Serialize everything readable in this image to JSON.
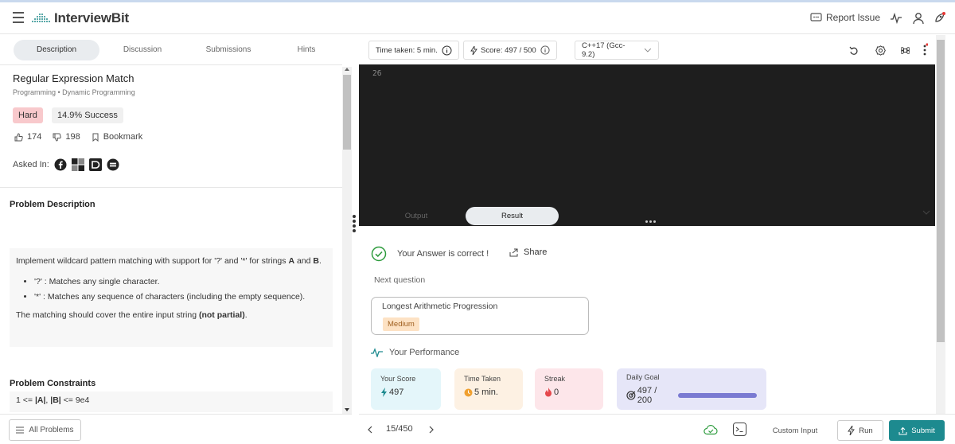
{
  "header": {
    "brand": "InterviewBit",
    "report_label": "Report Issue"
  },
  "left_tabs": [
    {
      "label": "Description",
      "active": true
    },
    {
      "label": "Discussion"
    },
    {
      "label": "Submissions"
    },
    {
      "label": "Hints"
    }
  ],
  "problem": {
    "title": "Regular Expression Match",
    "tags": "Programming • Dynamic Programming",
    "difficulty": "Hard",
    "success": "14.9% Success",
    "likes": "174",
    "dislikes": "198",
    "bookmark_label": "Bookmark",
    "asked_in_label": "Asked In:",
    "companies": [
      "facebook-icon",
      "microsoft-icon",
      "directi-icon",
      "company-icon"
    ]
  },
  "description": {
    "heading": "Problem Description",
    "intro_pre": "Implement wildcard pattern matching with support for '?' and '*' for strings ",
    "intro_a": "A",
    "intro_and": " and ",
    "intro_b": "B",
    "intro_end": ".",
    "bullet1": "'?' : Matches any single character.",
    "bullet2": "'*' : Matches any sequence of characters (including the empty sequence).",
    "match_pre": "The matching should cover the entire input string ",
    "match_bold": "(not partial)",
    "match_end": "."
  },
  "constraints": {
    "heading": "Problem Constraints",
    "pre": "1 <= ",
    "a": "|A|",
    "mid": ", ",
    "b": "|B|",
    "post": " <= 9e4"
  },
  "bottom_left": {
    "all_problems": "All Problems"
  },
  "toolbar": {
    "time_taken": "Time taken: 5 min.",
    "score": "Score: 497 / 500",
    "language": "C++17 (Gcc-9.2)"
  },
  "editor": {
    "line_number": "26"
  },
  "result_tabs": [
    {
      "label": "Output"
    },
    {
      "label": "Result",
      "active": true
    }
  ],
  "result": {
    "message": "Your Answer is correct !",
    "share": "Share",
    "next_label": "Next question",
    "next_title": "Longest Arithmetic Progression",
    "next_difficulty": "Medium",
    "performance_label": "Your Performance"
  },
  "performance": {
    "score_label": "Your Score",
    "score_value": "497",
    "time_label": "Time Taken",
    "time_value": "5 min.",
    "streak_label": "Streak",
    "streak_value": "0",
    "goal_label": "Daily Goal",
    "goal_value": "497 / 200",
    "goal_progress": 1.0
  },
  "bottom_right": {
    "page": "15/450",
    "custom_input": "Custom Input",
    "run": "Run",
    "submit": "Submit"
  },
  "colors": {
    "hard_bg": "#f8c9cc",
    "accent_teal": "#1d8a8f",
    "success_green": "#2e9c3e",
    "score_card": "#e4f6fa",
    "time_card": "#fdf1e3",
    "streak_card": "#fde6ea",
    "goal_card": "#e6e6f8"
  }
}
